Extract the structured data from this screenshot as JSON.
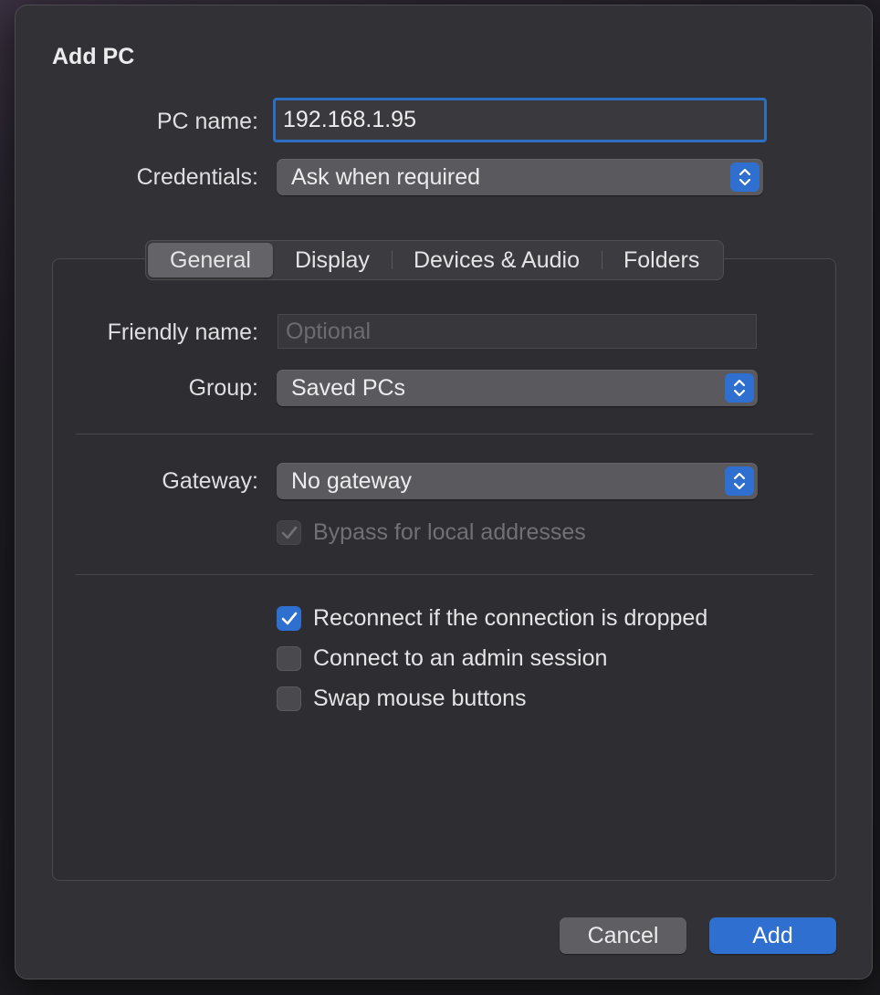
{
  "dialog": {
    "title": "Add PC"
  },
  "pc_name": {
    "label": "PC name:",
    "value": "192.168.1.95"
  },
  "credentials": {
    "label": "Credentials:",
    "selected": "Ask when required"
  },
  "tabs": [
    {
      "label": "General",
      "active": true
    },
    {
      "label": "Display",
      "active": false
    },
    {
      "label": "Devices & Audio",
      "active": false
    },
    {
      "label": "Folders",
      "active": false
    }
  ],
  "general": {
    "friendly_name": {
      "label": "Friendly name:",
      "placeholder": "Optional",
      "value": ""
    },
    "group": {
      "label": "Group:",
      "selected": "Saved PCs"
    },
    "gateway": {
      "label": "Gateway:",
      "selected": "No gateway"
    },
    "bypass_local": {
      "label": "Bypass for local addresses",
      "checked": true,
      "enabled": false
    },
    "reconnect": {
      "label": "Reconnect if the connection is dropped",
      "checked": true
    },
    "admin_session": {
      "label": "Connect to an admin session",
      "checked": false
    },
    "swap_mouse": {
      "label": "Swap mouse buttons",
      "checked": false
    }
  },
  "buttons": {
    "cancel": "Cancel",
    "add": "Add"
  },
  "colors": {
    "accent": "#2f6fd0",
    "dialog_bg": "#323236",
    "focus_ring": "#2d6ec2"
  },
  "icons": {
    "popup_stepper": "updown-chevron-icon",
    "checkmark": "checkmark-icon"
  }
}
